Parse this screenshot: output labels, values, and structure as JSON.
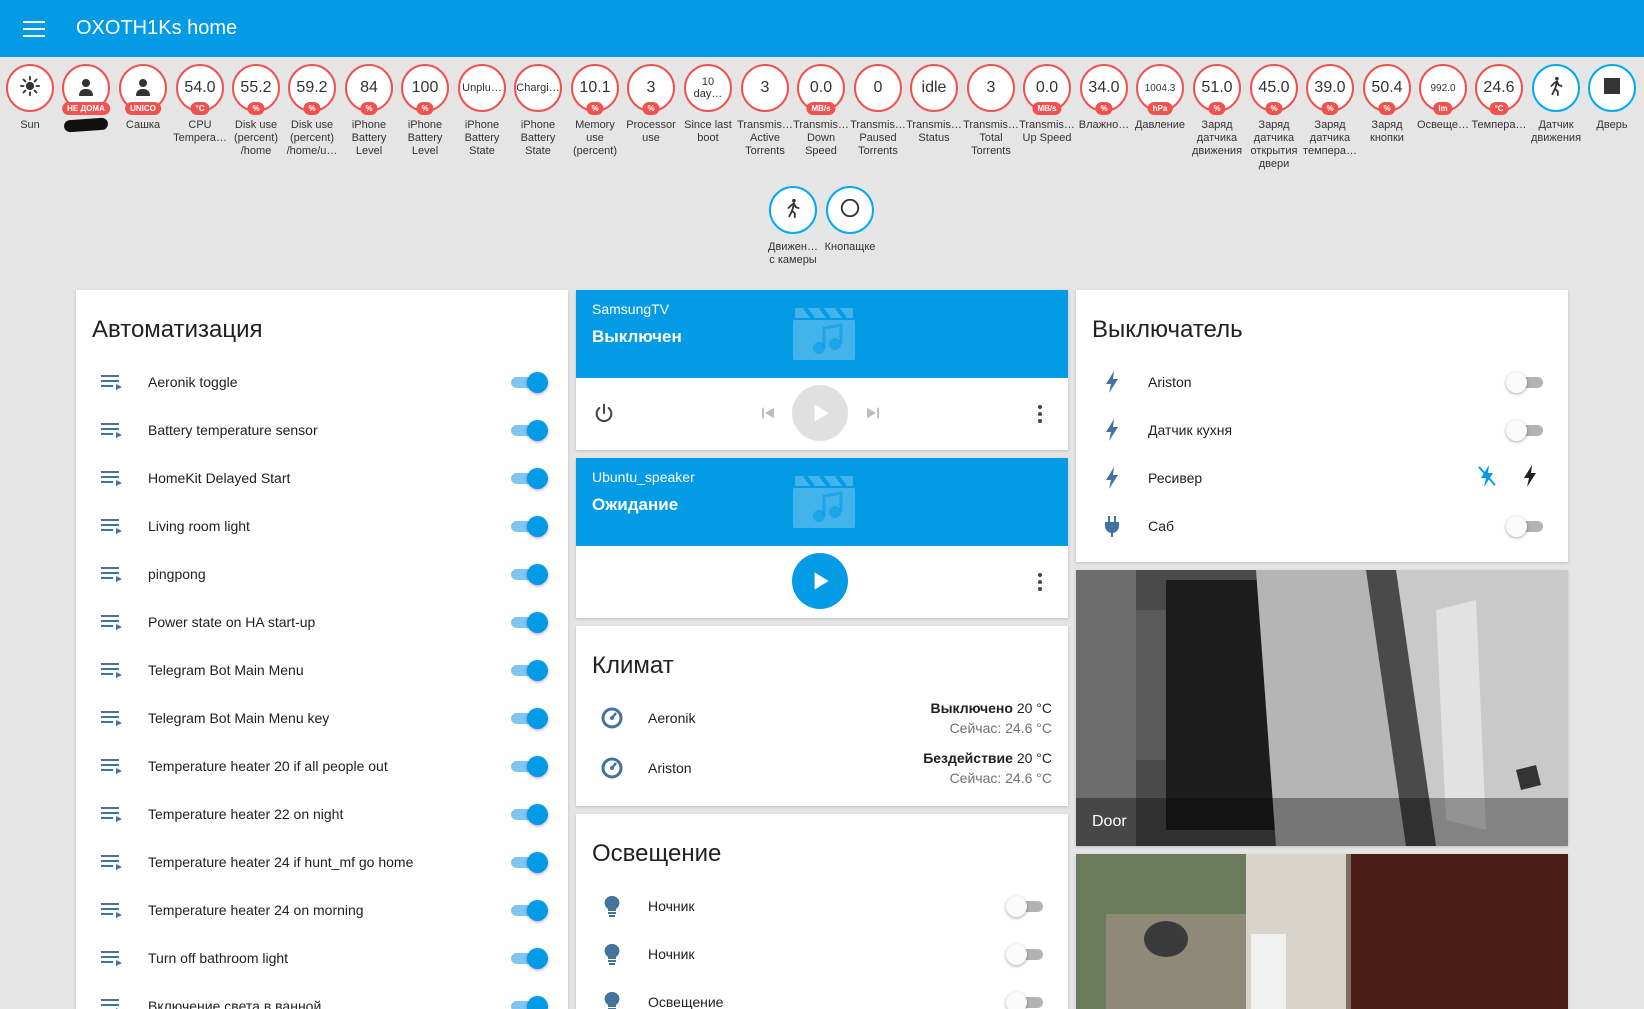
{
  "app": {
    "title": "OXOTH1Ks home"
  },
  "badges": [
    {
      "key": "sun",
      "value": "",
      "unit": "",
      "label": "Sun",
      "icon": "sun-icon",
      "color": "#ef5350"
    },
    {
      "key": "person1",
      "value": "",
      "unit": "НЕ ДОМА",
      "label": "",
      "icon": "person-icon",
      "color": "#ef5350"
    },
    {
      "key": "sashka",
      "value": "",
      "unit": "UNICO",
      "label": "Сашка",
      "icon": "person-icon",
      "color": "#ef5350"
    },
    {
      "key": "cpu",
      "value": "54.0",
      "unit": "°C",
      "label": "CPU Tempera…",
      "color": "#ef5350"
    },
    {
      "key": "disk1",
      "value": "55.2",
      "unit": "%",
      "label": "Disk use (percent) /home",
      "color": "#ef5350"
    },
    {
      "key": "disk2",
      "value": "59.2",
      "unit": "%",
      "label": "Disk use (percent) /home/u…",
      "color": "#ef5350"
    },
    {
      "key": "iph1",
      "value": "84",
      "unit": "%",
      "label": "iPhone Battery Level",
      "color": "#ef5350"
    },
    {
      "key": "iph2",
      "value": "100",
      "unit": "%",
      "label": "iPhone Battery Level",
      "color": "#ef5350"
    },
    {
      "key": "iph3",
      "value": "Unplu…",
      "unit": "",
      "label": "iPhone Battery State",
      "size": "small",
      "color": "#ef5350"
    },
    {
      "key": "iph4",
      "value": "Chargi…",
      "unit": "",
      "label": "iPhone Battery State",
      "size": "small",
      "color": "#ef5350"
    },
    {
      "key": "mem",
      "value": "10.1",
      "unit": "%",
      "label": "Memory use (percent)",
      "color": "#ef5350"
    },
    {
      "key": "proc",
      "value": "3",
      "unit": "%",
      "label": "Processor use",
      "color": "#ef5350"
    },
    {
      "key": "boot",
      "value": "10 day…",
      "unit": "",
      "label": "Since last boot",
      "size": "small",
      "color": "#ef5350"
    },
    {
      "key": "t1",
      "value": "3",
      "unit": "",
      "label": "Transmis… Active Torrents",
      "color": "#ef5350"
    },
    {
      "key": "t2",
      "value": "0.0",
      "unit": "MB/s",
      "label": "Transmis… Down Speed",
      "color": "#ef5350"
    },
    {
      "key": "t3",
      "value": "0",
      "unit": "",
      "label": "Transmis… Paused Torrents",
      "color": "#ef5350"
    },
    {
      "key": "t4",
      "value": "idle",
      "unit": "",
      "label": "Transmis… Status",
      "color": "#ef5350"
    },
    {
      "key": "t5",
      "value": "3",
      "unit": "",
      "label": "Transmis… Total Torrents",
      "color": "#ef5350"
    },
    {
      "key": "t6",
      "value": "0.0",
      "unit": "MB/s",
      "label": "Transmis… Up Speed",
      "color": "#ef5350"
    },
    {
      "key": "hum",
      "value": "34.0",
      "unit": "%",
      "label": "Влажно…",
      "color": "#ef5350"
    },
    {
      "key": "press",
      "value": "1004.3",
      "unit": "hPa",
      "label": "Давление",
      "size": "tiny",
      "color": "#ef5350"
    },
    {
      "key": "b1",
      "value": "51.0",
      "unit": "%",
      "label": "Заряд датчика движения",
      "color": "#ef5350"
    },
    {
      "key": "b2",
      "value": "45.0",
      "unit": "%",
      "label": "Заряд датчика открытия двери",
      "color": "#ef5350"
    },
    {
      "key": "b3",
      "value": "39.0",
      "unit": "%",
      "label": "Заряд датчика темпера…",
      "color": "#ef5350"
    },
    {
      "key": "b4",
      "value": "50.4",
      "unit": "%",
      "label": "Заряд кнопки",
      "color": "#ef5350"
    },
    {
      "key": "lux",
      "value": "992.0",
      "unit": "lm",
      "label": "Освеще…",
      "size": "tiny",
      "color": "#ef5350"
    },
    {
      "key": "temp",
      "value": "24.6",
      "unit": "°C",
      "label": "Темпера…",
      "color": "#ef5350"
    },
    {
      "key": "motion",
      "value": "",
      "unit": "",
      "label": "Датчик движения",
      "icon": "walk-icon",
      "color": "#03a9f4"
    },
    {
      "key": "door",
      "value": "",
      "unit": "",
      "label": "Дверь",
      "icon": "square-icon",
      "color": "#03a9f4"
    },
    {
      "key": "cam_motion",
      "value": "",
      "unit": "",
      "label": "Движен… с камеры",
      "icon": "walk-icon",
      "color": "#03a9f4"
    },
    {
      "key": "button",
      "value": "",
      "unit": "",
      "label": "Кнопащке",
      "icon": "circle-icon",
      "color": "#03a9f4"
    }
  ],
  "automation": {
    "title": "Автоматизация",
    "items": [
      {
        "label": "Aeronik toggle",
        "on": true
      },
      {
        "label": "Battery temperature sensor",
        "on": true
      },
      {
        "label": "HomeKit Delayed Start",
        "on": true
      },
      {
        "label": "Living room light",
        "on": true
      },
      {
        "label": "pingpong",
        "on": true
      },
      {
        "label": "Power state on HA start-up",
        "on": true
      },
      {
        "label": "Telegram Bot Main Menu",
        "on": true
      },
      {
        "label": "Telegram Bot Main Menu key",
        "on": true
      },
      {
        "label": "Temperature heater 20 if all people out",
        "on": true
      },
      {
        "label": "Temperature heater 22 on night",
        "on": true
      },
      {
        "label": "Temperature heater 24 if hunt_mf go home",
        "on": true
      },
      {
        "label": "Temperature heater 24 on morning",
        "on": true
      },
      {
        "label": "Turn off bathroom light",
        "on": true
      },
      {
        "label": "Включение света в ванной",
        "on": true
      }
    ]
  },
  "media": [
    {
      "source": "SamsungTV",
      "state": "Выключен"
    },
    {
      "source": "Ubuntu_speaker",
      "state": "Ожидание"
    }
  ],
  "climate": {
    "title": "Климат",
    "items": [
      {
        "name": "Aeronik",
        "state": "Выключено",
        "target": "20 °C",
        "current": "Сейчас: 24.6 °C"
      },
      {
        "name": "Ariston",
        "state": "Бездействие",
        "target": "20 °C",
        "current": "Сейчас: 24.6 °C"
      }
    ]
  },
  "lighting": {
    "title": "Освещение",
    "items": [
      {
        "label": "Ночник",
        "on": false
      },
      {
        "label": "Ночник",
        "on": false
      },
      {
        "label": "Освещение",
        "on": false
      }
    ]
  },
  "switches": {
    "title": "Выключатель",
    "items": [
      {
        "label": "Ariston",
        "type": "toggle",
        "on": false,
        "icon": "flash-icon"
      },
      {
        "label": "Датчик кухня",
        "type": "toggle",
        "on": false,
        "icon": "flash-icon"
      },
      {
        "label": "Ресивер",
        "type": "buttons",
        "icon": "flash-icon"
      },
      {
        "label": "Саб",
        "type": "toggle",
        "on": false,
        "icon": "power-plug-icon"
      }
    ]
  },
  "cameras": [
    {
      "name": "Door"
    },
    {
      "name": ""
    }
  ],
  "colors": {
    "primary": "#039be5",
    "badge_border": "#ef5350",
    "icon": "#44739e",
    "background": "#e5e5e5"
  }
}
